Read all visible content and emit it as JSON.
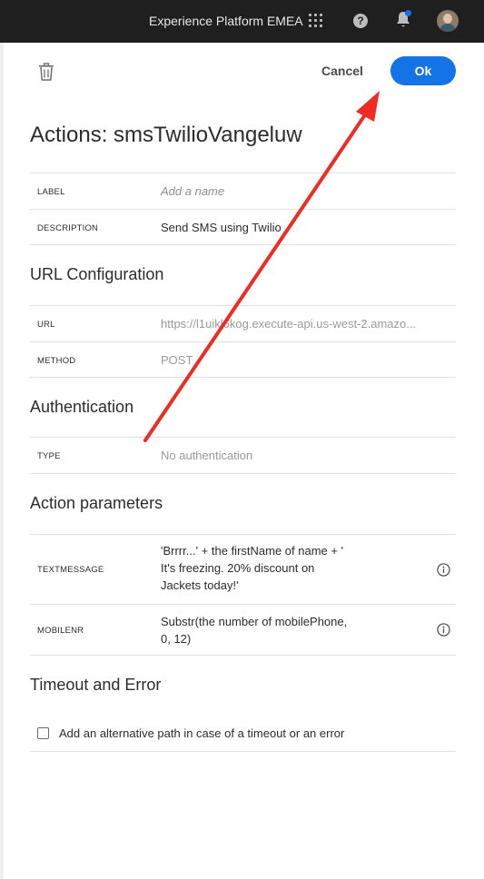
{
  "topbar": {
    "org_name": "Experience Platform EMEA",
    "help_label": "?"
  },
  "toolbar": {
    "cancel_label": "Cancel",
    "ok_label": "Ok"
  },
  "page_title": "Actions: smsTwilioVangeluw",
  "general": {
    "label_label": "LABEL",
    "label_placeholder": "Add a name",
    "description_label": "DESCRIPTION",
    "description_value": "Send SMS using Twilio"
  },
  "url_config": {
    "title": "URL Configuration",
    "url_label": "URL",
    "url_value": "https://l1uikl6kog.execute-api.us-west-2.amazo...",
    "method_label": "METHOD",
    "method_value": "POST"
  },
  "authentication": {
    "title": "Authentication",
    "type_label": "TYPE",
    "type_value": "No authentication"
  },
  "action_parameters": {
    "title": "Action parameters",
    "params": [
      {
        "label": "TEXTMESSAGE",
        "lines": [
          "'Brrrr...' + the firstName of name + '",
          "It's freezing. 20% discount on",
          "Jackets today!'"
        ]
      },
      {
        "label": "MOBILENR",
        "lines": [
          "Substr(the number of mobilePhone,",
          "0, 12)"
        ]
      }
    ]
  },
  "timeout": {
    "title": "Timeout and Error",
    "checkbox_label": "Add an alternative path in case of a timeout or an error",
    "checked": false
  },
  "colors": {
    "accent": "#1473e6",
    "topbar": "#1f1f1f",
    "annotation_arrow": "#ee2c24"
  }
}
